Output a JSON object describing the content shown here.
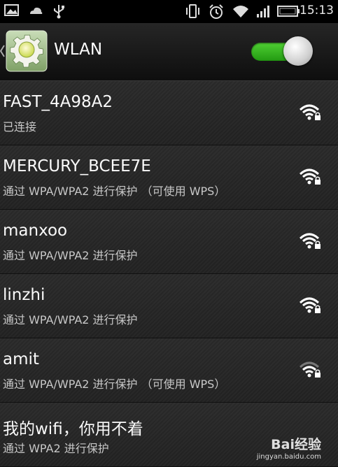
{
  "status_bar": {
    "time": "15:13",
    "left_icons": [
      "image-icon",
      "cloud-notification-icon",
      "usb-icon"
    ],
    "right_icons": [
      "vibrate-icon",
      "alarm-icon",
      "wifi-signal-icon",
      "cell-signal-icon",
      "battery-icon"
    ]
  },
  "action_bar": {
    "title": "WLAN",
    "toggle_on": true,
    "accent": "#3cbf24"
  },
  "networks": [
    {
      "ssid": "FAST_4A98A2",
      "status": "已连接",
      "secured": true,
      "signal": "strong"
    },
    {
      "ssid": "MERCURY_BCEE7E",
      "status": "通过 WPA/WPA2 进行保护 （可使用 WPS）",
      "secured": true,
      "signal": "strong"
    },
    {
      "ssid": "manxoo",
      "status": "通过 WPA/WPA2 进行保护",
      "secured": true,
      "signal": "strong"
    },
    {
      "ssid": "linzhi",
      "status": "通过 WPA/WPA2 进行保护",
      "secured": true,
      "signal": "strong"
    },
    {
      "ssid": "amit",
      "status": "通过 WPA/WPA2 进行保护 （可使用 WPS）",
      "secured": true,
      "signal": "medium"
    },
    {
      "ssid": "我的wifi，你用不着",
      "status": "通过 WPA2 进行保护",
      "secured": true,
      "signal": "strong"
    }
  ],
  "watermark": {
    "logo": "Bai经验",
    "url": "jingyan.baidu.com"
  }
}
